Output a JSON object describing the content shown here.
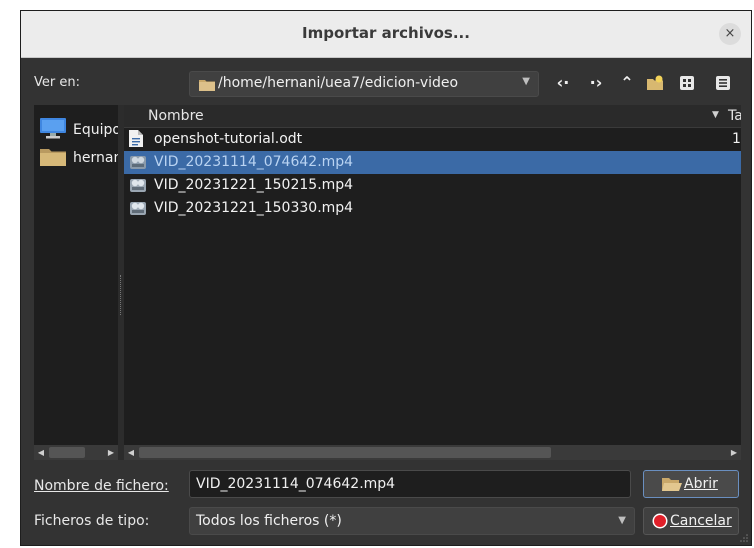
{
  "window": {
    "title": "Importar archivos...",
    "close_glyph": "×"
  },
  "toolbar": {
    "lookin_label": "Ver en:",
    "path": "/home/hernani/uea7/edicion-video",
    "buttons": [
      {
        "name": "back-icon",
        "glyph": "‹·"
      },
      {
        "name": "forward-icon",
        "glyph": "·›"
      },
      {
        "name": "parent-dir-icon",
        "glyph": "⌃"
      },
      {
        "name": "new-folder-icon"
      },
      {
        "name": "icon-view-icon"
      },
      {
        "name": "detail-view-icon"
      }
    ]
  },
  "sidebar": {
    "items": [
      {
        "label": "Equipo",
        "icon": "computer-icon"
      },
      {
        "label": "hernani",
        "icon": "folder-icon"
      }
    ]
  },
  "files": {
    "columns": {
      "name": "Nombre",
      "size": "Tamaño"
    },
    "rows": [
      {
        "name": "openshot-tutorial.odt",
        "icon": "document-icon",
        "size": "1",
        "selected": false
      },
      {
        "name": "VID_20231114_074642.mp4",
        "icon": "video-file-icon",
        "size": "",
        "selected": true
      },
      {
        "name": "VID_20231221_150215.mp4",
        "icon": "video-file-icon",
        "size": "",
        "selected": false
      },
      {
        "name": "VID_20231221_150330.mp4",
        "icon": "video-file-icon",
        "size": "",
        "selected": false
      }
    ]
  },
  "form": {
    "filename_label": "Nombre de fichero:",
    "filename_value": "VID_20231114_074642.mp4",
    "filetype_label": "Ficheros de tipo:",
    "filetype_value": "Todos los ficheros (*)",
    "open_label": "Abrir",
    "cancel_label": "Cancelar"
  },
  "colors": {
    "accent": "#3b6aa6",
    "background": "#333333",
    "list_bg": "#1e1e1e",
    "titlebar": "#ececec"
  }
}
